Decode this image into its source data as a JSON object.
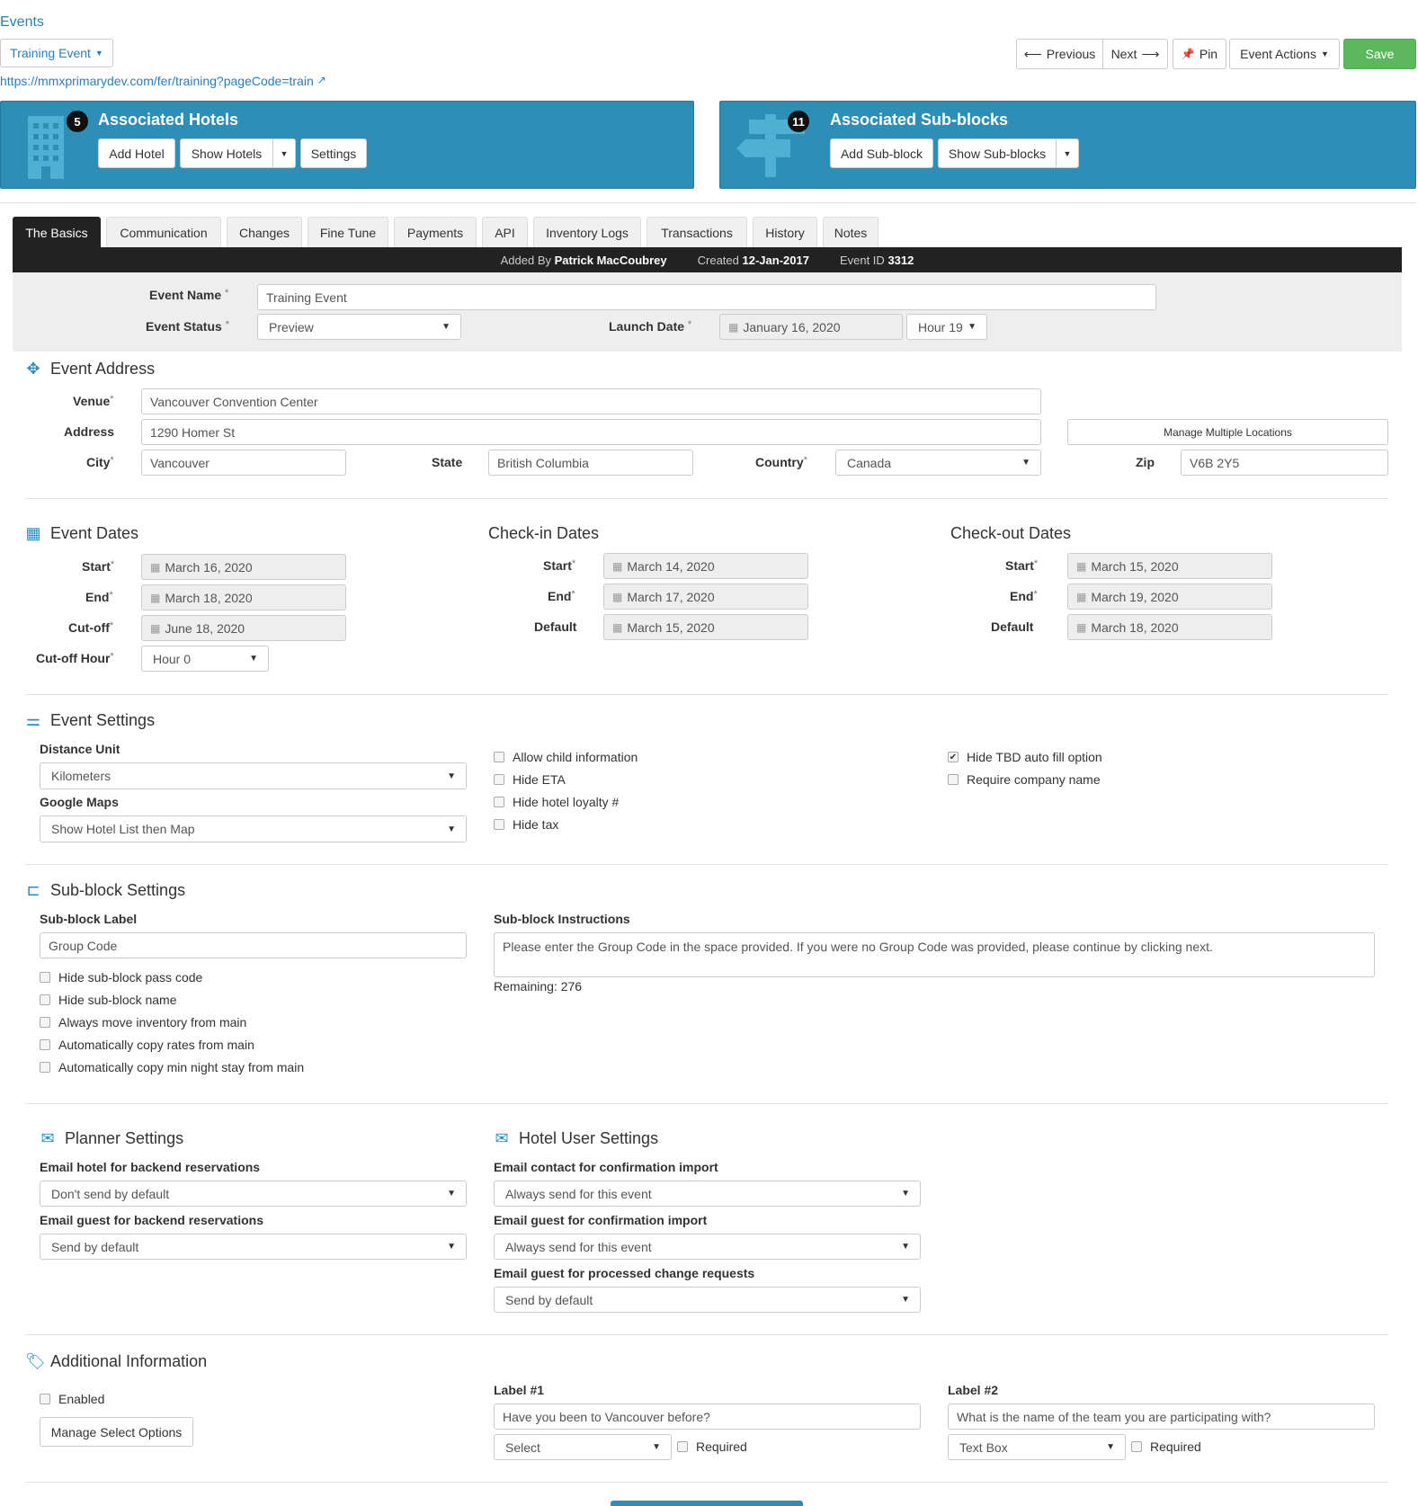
{
  "header": {
    "breadcrumb": "Events",
    "event_dropdown": "Training Event",
    "url": "https://mmxprimarydev.com/fer/training?pageCode=train",
    "toolbar": {
      "previous": "Previous",
      "next": "Next",
      "pin": "Pin",
      "event_actions": "Event Actions",
      "save": "Save"
    }
  },
  "hotels_panel": {
    "count": "5",
    "title": "Associated Hotels",
    "add": "Add Hotel",
    "show": "Show Hotels",
    "settings": "Settings"
  },
  "subblocks_panel": {
    "count": "11",
    "title": "Associated Sub-blocks",
    "add": "Add Sub-block",
    "show": "Show Sub-blocks"
  },
  "tabs": [
    "The Basics",
    "Communication",
    "Changes",
    "Fine Tune",
    "Payments",
    "API",
    "Inventory Logs",
    "Transactions",
    "History",
    "Notes"
  ],
  "meta": {
    "added_by_label": "Added By",
    "added_by": "Patrick MacCoubrey",
    "created_label": "Created",
    "created": "12-Jan-2017",
    "event_id_label": "Event ID",
    "event_id": "3312"
  },
  "basics": {
    "event_name_label": "Event Name",
    "event_name": "Training Event",
    "event_status_label": "Event Status",
    "event_status": "Preview",
    "launch_date_label": "Launch Date",
    "launch_date": "January 16, 2020",
    "launch_hour": "Hour 19"
  },
  "address": {
    "title": "Event Address",
    "venue_label": "Venue",
    "venue": "Vancouver Convention Center",
    "address_label": "Address",
    "address": "1290 Homer St",
    "manage_locations": "Manage Multiple Locations",
    "city_label": "City",
    "city": "Vancouver",
    "state_label": "State",
    "state": "British Columbia",
    "country_label": "Country",
    "country": "Canada",
    "zip_label": "Zip",
    "zip": "V6B 2Y5"
  },
  "event_dates": {
    "title": "Event Dates",
    "start_label": "Start",
    "start": "March 16, 2020",
    "end_label": "End",
    "end": "March 18, 2020",
    "cutoff_label": "Cut-off",
    "cutoff": "June 18, 2020",
    "cutoff_hour_label": "Cut-off Hour",
    "cutoff_hour": "Hour 0"
  },
  "checkin_dates": {
    "title": "Check-in Dates",
    "start_label": "Start",
    "start": "March 14, 2020",
    "end_label": "End",
    "end": "March 17, 2020",
    "default_label": "Default",
    "default": "March 15, 2020"
  },
  "checkout_dates": {
    "title": "Check-out Dates",
    "start_label": "Start",
    "start": "March 15, 2020",
    "end_label": "End",
    "end": "March 19, 2020",
    "default_label": "Default",
    "default": "March 18, 2020"
  },
  "event_settings": {
    "title": "Event Settings",
    "distance_unit_label": "Distance Unit",
    "distance_unit": "Kilometers",
    "google_maps_label": "Google Maps",
    "google_maps": "Show Hotel List then Map",
    "checkboxes_col1": [
      {
        "label": "Allow child information",
        "checked": false
      },
      {
        "label": "Hide ETA",
        "checked": false
      },
      {
        "label": "Hide hotel loyalty #",
        "checked": false
      },
      {
        "label": "Hide tax",
        "checked": false
      }
    ],
    "checkboxes_col2": [
      {
        "label": "Hide TBD auto fill option",
        "checked": true
      },
      {
        "label": "Require company name",
        "checked": false
      }
    ]
  },
  "subblock_settings": {
    "title": "Sub-block Settings",
    "label_label": "Sub-block Label",
    "label_value": "Group Code",
    "instructions_label": "Sub-block Instructions",
    "instructions": "Please enter the Group Code in the space provided. If you were no Group Code was provided, please continue by clicking next.",
    "remaining": "Remaining: 276",
    "checkboxes": [
      {
        "label": "Hide sub-block pass code",
        "checked": false
      },
      {
        "label": "Hide sub-block name",
        "checked": false
      },
      {
        "label": "Always move inventory from main",
        "checked": false
      },
      {
        "label": "Automatically copy rates from main",
        "checked": false
      },
      {
        "label": "Automatically copy min night stay from main",
        "checked": false
      }
    ]
  },
  "planner_settings": {
    "title": "Planner Settings",
    "backend_hotel_label": "Email hotel for backend reservations",
    "backend_hotel": "Don't send by default",
    "backend_guest_label": "Email guest for backend reservations",
    "backend_guest": "Send by default"
  },
  "hotel_user_settings": {
    "title": "Hotel User Settings",
    "contact_import_label": "Email contact for confirmation import",
    "contact_import": "Always send for this event",
    "guest_import_label": "Email guest for confirmation import",
    "guest_import": "Always send for this event",
    "change_requests_label": "Email guest for processed change requests",
    "change_requests": "Send by default"
  },
  "additional_info": {
    "title": "Additional Information",
    "enabled_label": "Enabled",
    "manage_select_options": "Manage Select Options",
    "label1_title": "Label #1",
    "label1": "Have you been to Vancouver before?",
    "label1_type": "Select",
    "label2_title": "Label #2",
    "label2": "What is the name of the team you are participating with?",
    "label2_type": "Text Box",
    "required": "Required"
  },
  "colors": {
    "panel": "#2d8fb5",
    "save": "#5cb85c",
    "link": "#2a7fb8",
    "active_tab": "#222222"
  }
}
